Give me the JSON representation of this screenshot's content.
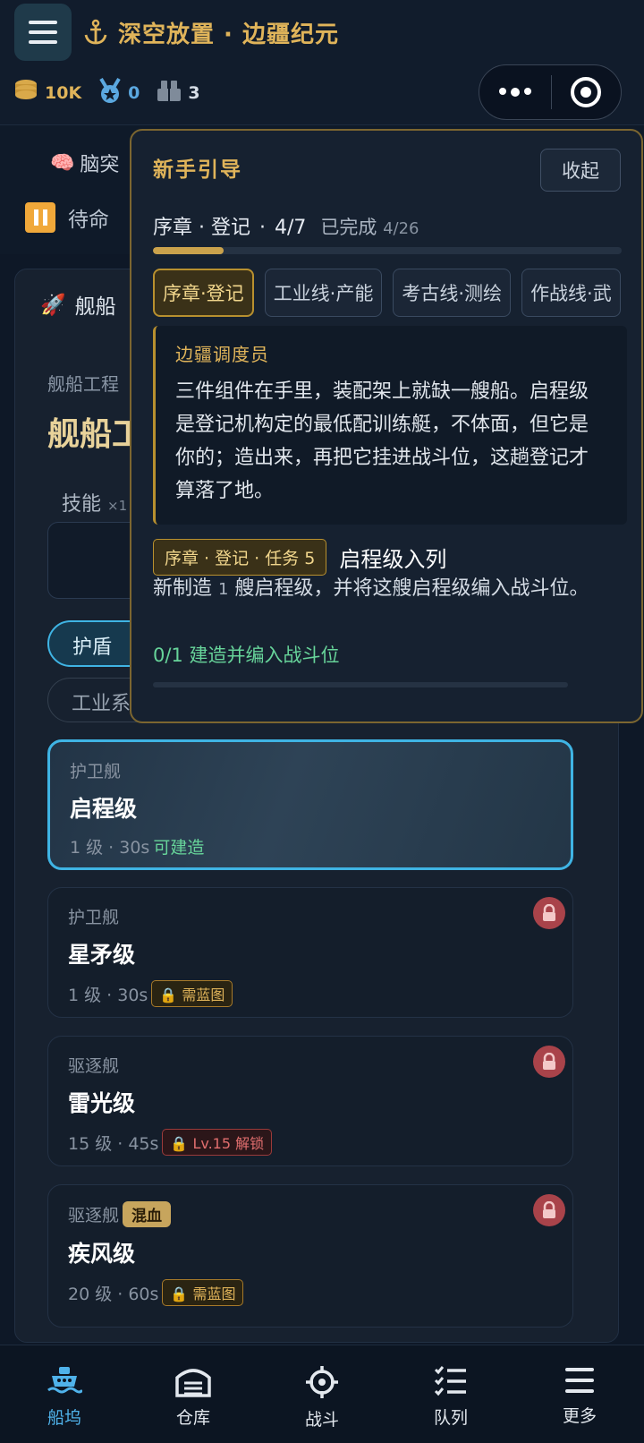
{
  "header": {
    "title": "深空放置 · 边疆纪元",
    "resources": [
      {
        "icon": "coins-icon",
        "value": "10K"
      },
      {
        "icon": "medal-icon",
        "value": "0"
      },
      {
        "icon": "blocks-icon",
        "value": "3"
      }
    ]
  },
  "background": {
    "brain_label": "脑突",
    "status_label": "待命",
    "panel_title": "舰船",
    "crumb": "舰船工程",
    "big_title": "舰船工",
    "skill_label": "技能",
    "skill_count": "×1",
    "chips": [
      "护盾",
      "工业系"
    ]
  },
  "ships": [
    {
      "class": "护卫舰",
      "name": "启程级",
      "meta": "1 级 · 30s",
      "status": "可建造",
      "locked": false
    },
    {
      "class": "护卫舰",
      "name": "星矛级",
      "meta": "1 级 · 30s",
      "tag": "需蓝图",
      "locked": true
    },
    {
      "class": "驱逐舰",
      "name": "雷光级",
      "meta": "15 级 · 45s",
      "tag": "Lv.15 解锁",
      "locked": true
    },
    {
      "class": "驱逐舰",
      "class_tag": "混血",
      "name": "疾风级",
      "meta": "20 级 · 60s",
      "tag": "需蓝图",
      "locked": true
    }
  ],
  "guide": {
    "title": "新手引导",
    "collapse": "收起",
    "chapter": "序章 · 登记",
    "step": "4/7",
    "completed_label": "已完成",
    "completed_count": "4/26",
    "progress_fraction": 0.15,
    "tabs": [
      "序章·登记",
      "工业线·产能",
      "考古线·测绘",
      "作战线·武"
    ],
    "speaker": "边疆调度员",
    "speech": "三件组件在手里，装配架上就缺一艘船。启程级是登记机构定的最低配训练艇，不体面，但它是你的；造出来，再把它挂进战斗位，这趟登记才算落了地。",
    "task_badge": "序章 · 登记 · 任务 5",
    "task_name": "启程级入列",
    "task_desc_a": "新制造",
    "task_desc_num": "1",
    "task_desc_b": "艘启程级，并将这艘启程级编入战斗位。",
    "task_progress": "0/1 建造并编入战斗位"
  },
  "nav": [
    {
      "label": "船坞",
      "icon": "ship-icon",
      "active": true
    },
    {
      "label": "仓库",
      "icon": "warehouse-icon",
      "active": false
    },
    {
      "label": "战斗",
      "icon": "crosshair-icon",
      "active": false
    },
    {
      "label": "队列",
      "icon": "checklist-icon",
      "active": false
    },
    {
      "label": "更多",
      "icon": "menu-icon",
      "active": false
    }
  ],
  "colors": {
    "accent": "#3fb4e4",
    "gold": "#e0b45a",
    "ok": "#67d49a",
    "danger": "#e16e6e"
  }
}
